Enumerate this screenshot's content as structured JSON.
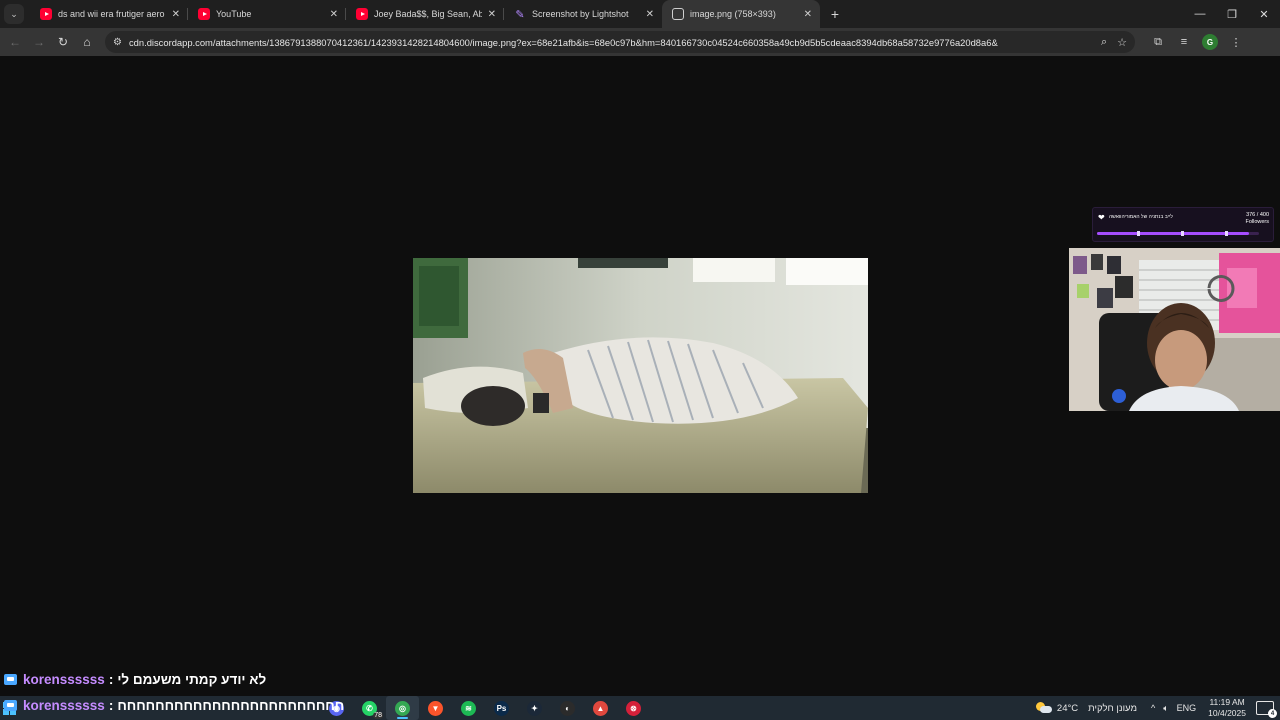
{
  "browser": {
    "tabs": [
      {
        "title": "ds and wii era frutiger aero",
        "favicon": "youtube-icon",
        "active": false
      },
      {
        "title": "YouTube",
        "favicon": "youtube-icon",
        "active": false
      },
      {
        "title": "Joey Bada$$, Big Sean, Ab-Soul",
        "favicon": "youtube-icon",
        "active": false
      },
      {
        "title": "Screenshot by Lightshot",
        "favicon": "lightshot-icon",
        "active": false
      },
      {
        "title": "image.png (758×393)",
        "favicon": "globe-icon",
        "active": true
      }
    ],
    "url": "cdn.discordapp.com/attachments/1386791388070412361/1423931428214804600/image.png?ex=68e21afb&is=68e0c97b&hm=840166730c04524c660358a49cb9d5b5cdeaac8394db68a58732e9776a20d8a6&",
    "profile_initial": "G"
  },
  "overlay": {
    "follow_goal": {
      "title": "לייב בנתניה של האמוריהוואשה",
      "count": "376 / 400",
      "label": "Followers",
      "progress": 0.94
    },
    "chat": [
      {
        "user": "korenssssss",
        "separator": ":",
        "message": "לא יודע קמתי משעמם לי"
      },
      {
        "user": "korenssssss",
        "separator": ":",
        "message": "חחחחחחחחחחחחחחחחחחחחחחחח"
      }
    ]
  },
  "taskbar": {
    "apps": [
      {
        "name": "discord-icon",
        "color": "#5865f2",
        "glyph": "◉"
      },
      {
        "name": "whatsapp-icon",
        "color": "#25d366",
        "glyph": "✆",
        "badge": "78"
      },
      {
        "name": "chrome-icon",
        "color": "#34a853",
        "glyph": "◎",
        "active": true
      },
      {
        "name": "brave-icon",
        "color": "#fb542b",
        "glyph": "▼"
      },
      {
        "name": "spotify-icon",
        "color": "#1db954",
        "glyph": "≋"
      },
      {
        "name": "photoshop-icon",
        "color": "#0b2a4a",
        "glyph": "Ps"
      },
      {
        "name": "steam-icon",
        "color": "#1b2838",
        "glyph": "✦"
      },
      {
        "name": "obs-icon",
        "color": "#2b2b2b",
        "glyph": "◐"
      },
      {
        "name": "tool-icon",
        "color": "#e0483e",
        "glyph": "▲"
      },
      {
        "name": "app-red-icon",
        "color": "#d4203a",
        "glyph": "⊗"
      }
    ],
    "weather": {
      "temp": "24°C",
      "condition": "מעונן חלקית"
    },
    "language": "ENG",
    "time": "11:19 AM",
    "date": "10/4/2025",
    "notifications": "4"
  },
  "colors": {
    "chat_username": "#c58cff",
    "follow_bar": "#a64dff",
    "taskbar_accent": "#4cc2ff"
  }
}
